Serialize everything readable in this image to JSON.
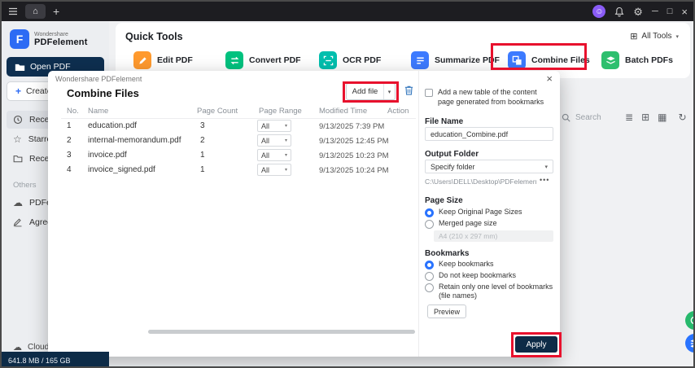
{
  "colors": {
    "navy": "#0d2b47",
    "accent_blue": "#2973ff",
    "annotation_red": "#e8112d"
  },
  "sidebar": {
    "brand_top": "Wondershare",
    "brand_bottom": "PDFelement",
    "open_pdf_label": "Open PDF",
    "create_pdf_label": "Create PDF",
    "nav_items": [
      {
        "label": "Recent"
      },
      {
        "label": "Starred"
      },
      {
        "label": "Recent"
      }
    ],
    "others_label": "Others",
    "other_items": [
      {
        "label": "PDFelement Cloud"
      },
      {
        "label": "Agreement"
      }
    ],
    "cloud_storage_label": "Cloud Storage",
    "storage_usage": "641.8 MB / 165 GB"
  },
  "main": {
    "quick_tools_title": "Quick Tools",
    "all_tools_label": "All Tools",
    "search_label": "Search",
    "tools": [
      {
        "label": "Edit PDF",
        "color": "#ff9a2e"
      },
      {
        "label": "Convert PDF",
        "color": "#00c27f"
      },
      {
        "label": "OCR PDF",
        "color": "#00bfae"
      },
      {
        "label": "Summarize PDF",
        "color": "#3d7bff"
      },
      {
        "label": "Combine Files",
        "color": "#3d7bff"
      },
      {
        "label": "Batch PDFs",
        "color": "#2dbf6e"
      }
    ]
  },
  "dialog": {
    "window_title": "Wondershare PDFelement",
    "title": "Combine Files",
    "add_file_label": "Add file",
    "table": {
      "headers": [
        "No.",
        "Name",
        "Page Count",
        "Page Range",
        "Modified Time",
        "Action"
      ],
      "rows": [
        {
          "no": "1",
          "name": "education.pdf",
          "page_count": "3",
          "page_range": "All",
          "modified": "9/13/2025 7:39 PM"
        },
        {
          "no": "2",
          "name": "internal-memorandum.pdf",
          "page_count": "2",
          "page_range": "All",
          "modified": "9/13/2025 12:45 PM"
        },
        {
          "no": "3",
          "name": "invoice.pdf",
          "page_count": "1",
          "page_range": "All",
          "modified": "9/13/2025 10:23 PM"
        },
        {
          "no": "4",
          "name": "invoice_signed.pdf",
          "page_count": "1",
          "page_range": "All",
          "modified": "9/13/2025 10:24 PM"
        }
      ]
    },
    "toc_checkbox_label": "Add a new table of the content page generated from bookmarks",
    "file_name_label": "File Name",
    "file_name_value": "education_Combine.pdf",
    "output_folder_label": "Output Folder",
    "output_folder_value": "Specify folder",
    "output_path": "C:\\Users\\DELL\\Desktop\\PDFelement\\Com",
    "page_size": {
      "label": "Page Size",
      "options": [
        {
          "label": "Keep Original Page Sizes",
          "selected": true
        },
        {
          "label": "Merged page size",
          "selected": false
        }
      ],
      "merged_size_value": "A4 (210 x 297 mm)"
    },
    "bookmarks": {
      "label": "Bookmarks",
      "options": [
        {
          "label": "Keep bookmarks",
          "selected": true
        },
        {
          "label": "Do not keep bookmarks",
          "selected": false
        },
        {
          "label": "Retain only one level of bookmarks (file names)",
          "selected": false
        }
      ]
    },
    "preview_label": "Preview",
    "apply_label": "Apply"
  }
}
